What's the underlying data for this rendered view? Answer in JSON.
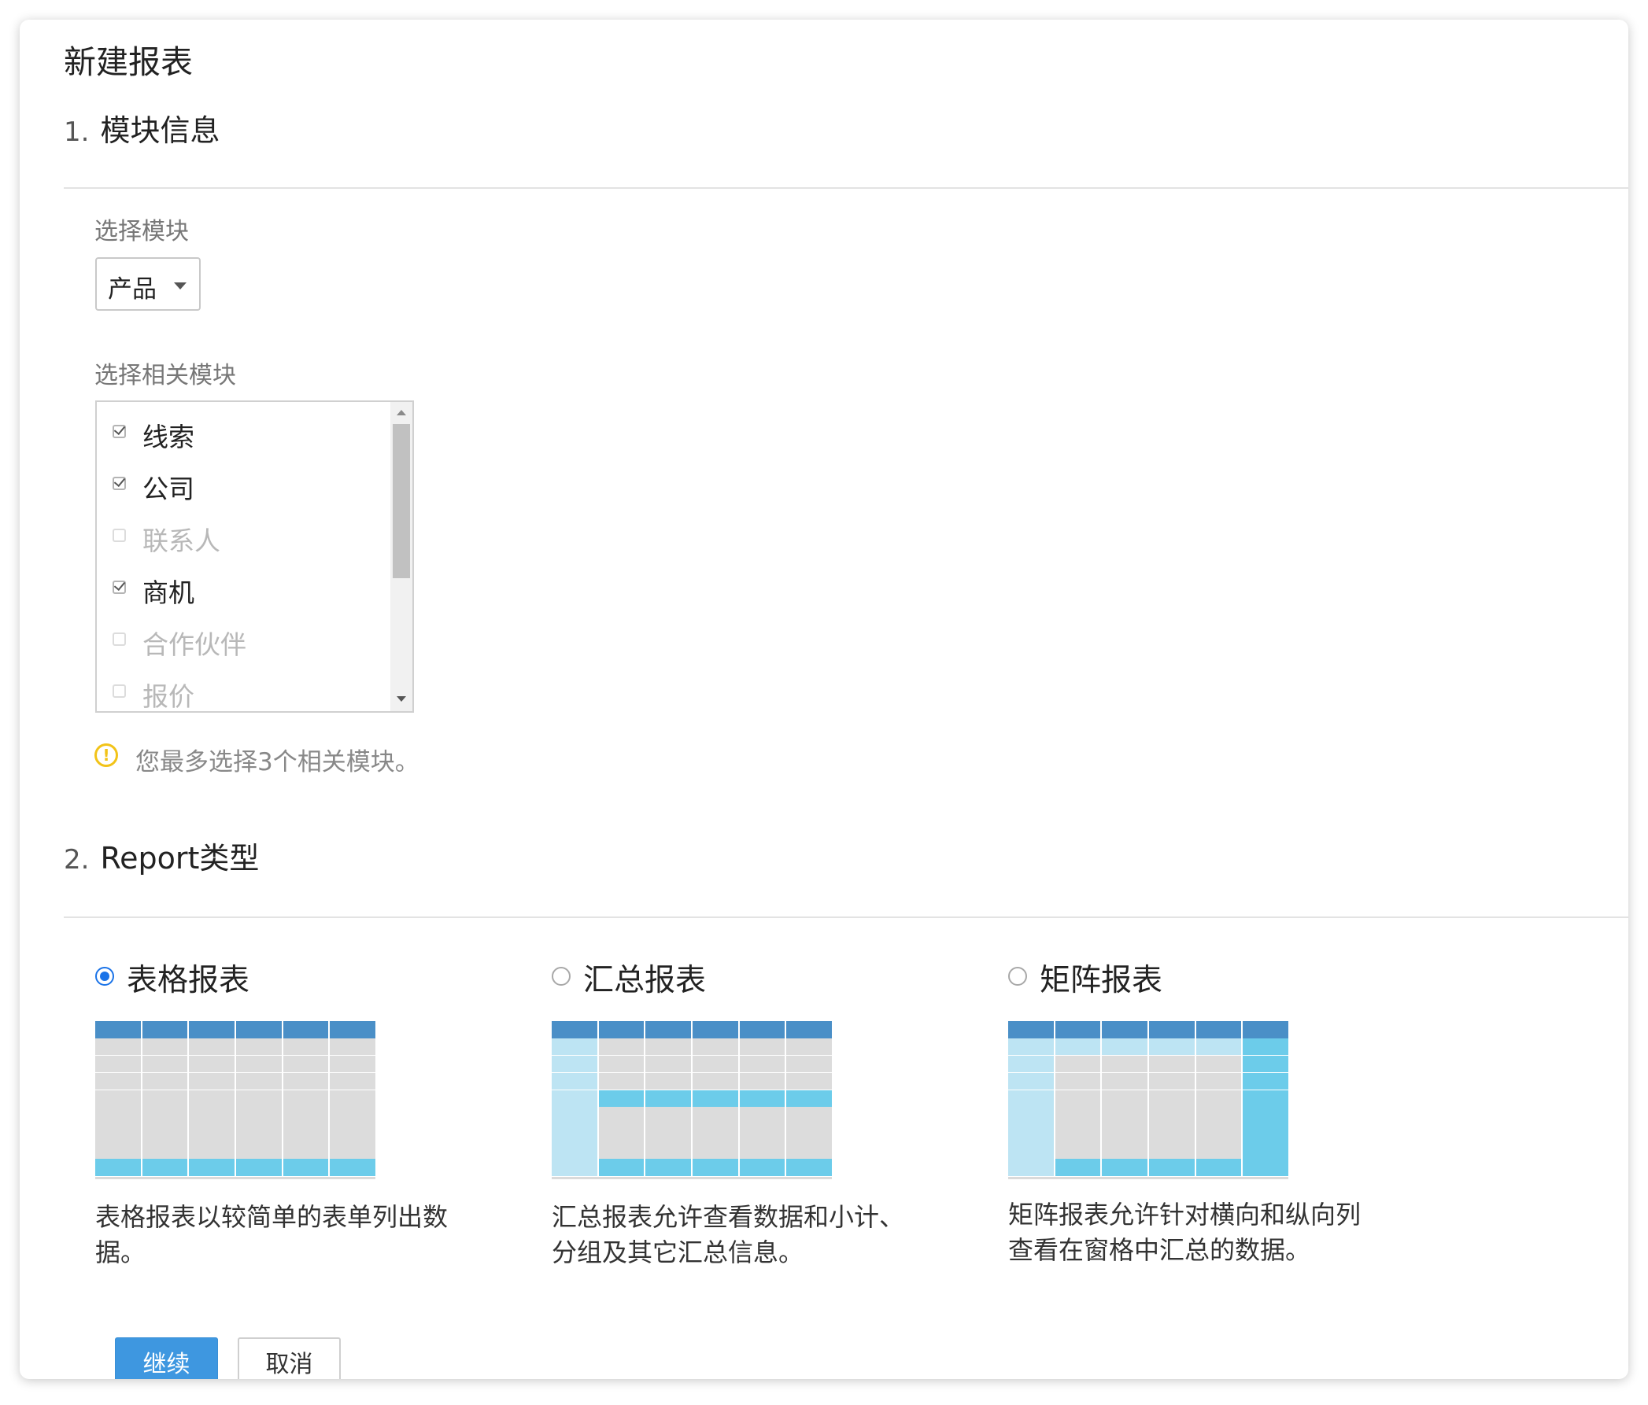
{
  "page": {
    "title": "新建报表"
  },
  "section1": {
    "number": "1.",
    "title": "模块信息",
    "module_label": "选择模块",
    "module_value": "产品",
    "related_label": "选择相关模块",
    "related_items": [
      {
        "label": "线索",
        "checked": true
      },
      {
        "label": "公司",
        "checked": true
      },
      {
        "label": "联系人",
        "checked": false
      },
      {
        "label": "商机",
        "checked": true
      },
      {
        "label": "合作伙伴",
        "checked": false
      },
      {
        "label": "报价",
        "checked": false
      }
    ],
    "note": "您最多选择3个相关模块。",
    "note_icon": "!"
  },
  "section2": {
    "number": "2.",
    "title": "Report类型",
    "selected": "table",
    "options": [
      {
        "id": "table",
        "label": "表格报表",
        "desc": "表格报表以较简单的表单列出数据。"
      },
      {
        "id": "summary",
        "label": "汇总报表",
        "desc": "汇总报表允许查看数据和小计、分组及其它汇总信息。"
      },
      {
        "id": "matrix",
        "label": "矩阵报表",
        "desc": "矩阵报表允许针对横向和纵向列查看在窗格中汇总的数据。"
      }
    ]
  },
  "colors": {
    "header": "#4a8fc7",
    "cell": "#dcdcdc",
    "light": "#bde4f3",
    "accent": "#6cccea",
    "primary_button": "#3e97e0",
    "radio_selected": "#1a73e8",
    "warning": "#f2c318"
  },
  "buttons": {
    "continue": "继续",
    "cancel": "取消"
  }
}
